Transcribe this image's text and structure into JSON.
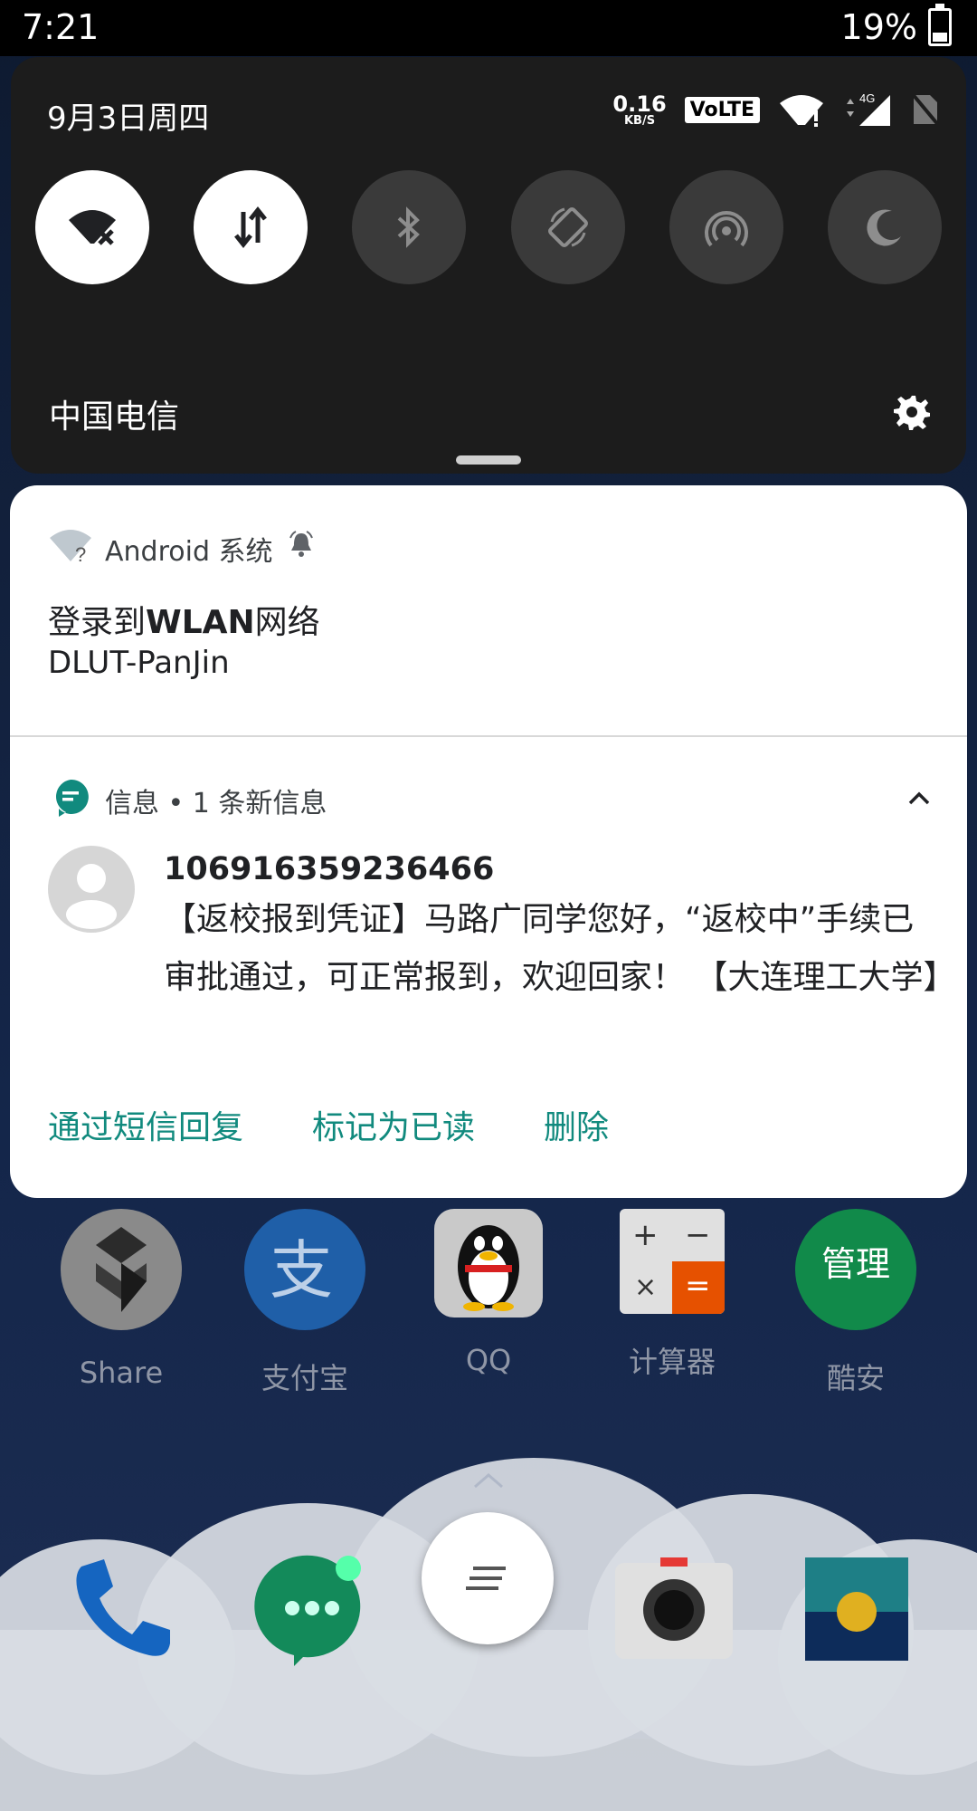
{
  "status_bar": {
    "time": "7:21",
    "battery": "19%"
  },
  "quick_settings": {
    "date": "9月3日周四",
    "net_speed_value": "0.16",
    "net_speed_unit": "KB/S",
    "volte": "VoLTE",
    "network_type": "4G",
    "carrier": "中国电信",
    "tiles": [
      {
        "name": "wifi",
        "state": "on",
        "icon": "wifi-off-icon"
      },
      {
        "name": "mobile-data",
        "state": "on",
        "icon": "data-arrows-icon"
      },
      {
        "name": "bluetooth",
        "state": "off",
        "icon": "bluetooth-icon"
      },
      {
        "name": "auto-rotate",
        "state": "off",
        "icon": "rotate-icon"
      },
      {
        "name": "hotspot",
        "state": "off",
        "icon": "hotspot-icon"
      },
      {
        "name": "night-mode",
        "state": "off",
        "icon": "moon-icon"
      }
    ]
  },
  "notifications": {
    "wifi": {
      "app": "Android 系统",
      "title_prefix": "登录到",
      "title_bold": "WLAN",
      "title_suffix": "网络",
      "text": "DLUT-PanJin"
    },
    "messages": {
      "header": "信息 • 1 条新信息",
      "sender": "106916359236466",
      "body": "【返校报到凭证】马路广同学您好，“返校中”手续已审批通过，可正常报到，欢迎回家！ 【大连理工大学】",
      "actions": [
        "通过短信回复",
        "标记为已读",
        "删除"
      ],
      "accent": "#118a7e"
    }
  },
  "home_apps": [
    {
      "label": "Share"
    },
    {
      "label": "支付宝"
    },
    {
      "label": "QQ"
    },
    {
      "label": "计算器"
    },
    {
      "label": "酷安",
      "badge": "管理"
    }
  ]
}
